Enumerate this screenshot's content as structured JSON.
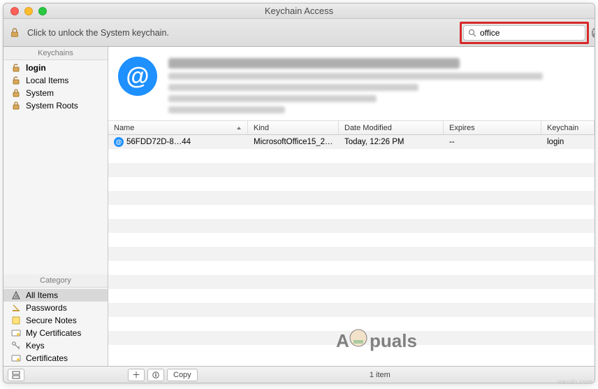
{
  "window": {
    "title": "Keychain Access"
  },
  "toolbar": {
    "lock_message": "Click to unlock the System keychain.",
    "search_value": "office"
  },
  "sidebar": {
    "keychains_header": "Keychains",
    "category_header": "Category",
    "keychains": [
      {
        "label": "login",
        "icon": "unlocked",
        "bold": true
      },
      {
        "label": "Local Items",
        "icon": "unlocked"
      },
      {
        "label": "System",
        "icon": "locked"
      },
      {
        "label": "System Roots",
        "icon": "locked"
      }
    ],
    "categories": [
      {
        "label": "All Items",
        "icon": "all",
        "selected": true
      },
      {
        "label": "Passwords",
        "icon": "passwords"
      },
      {
        "label": "Secure Notes",
        "icon": "notes"
      },
      {
        "label": "My Certificates",
        "icon": "certs"
      },
      {
        "label": "Keys",
        "icon": "keys"
      },
      {
        "label": "Certificates",
        "icon": "certs"
      }
    ]
  },
  "table": {
    "headers": {
      "name": "Name",
      "kind": "Kind",
      "date_modified": "Date Modified",
      "expires": "Expires",
      "keychain": "Keychain"
    },
    "rows": [
      {
        "name": "56FDD72D-8…44",
        "kind": "MicrosoftOffice15_2…",
        "date_modified": "Today, 12:26 PM",
        "expires": "--",
        "keychain": "login"
      }
    ]
  },
  "statusbar": {
    "copy_label": "Copy",
    "count_text": "1 item"
  },
  "watermark": "wsxdn.com"
}
